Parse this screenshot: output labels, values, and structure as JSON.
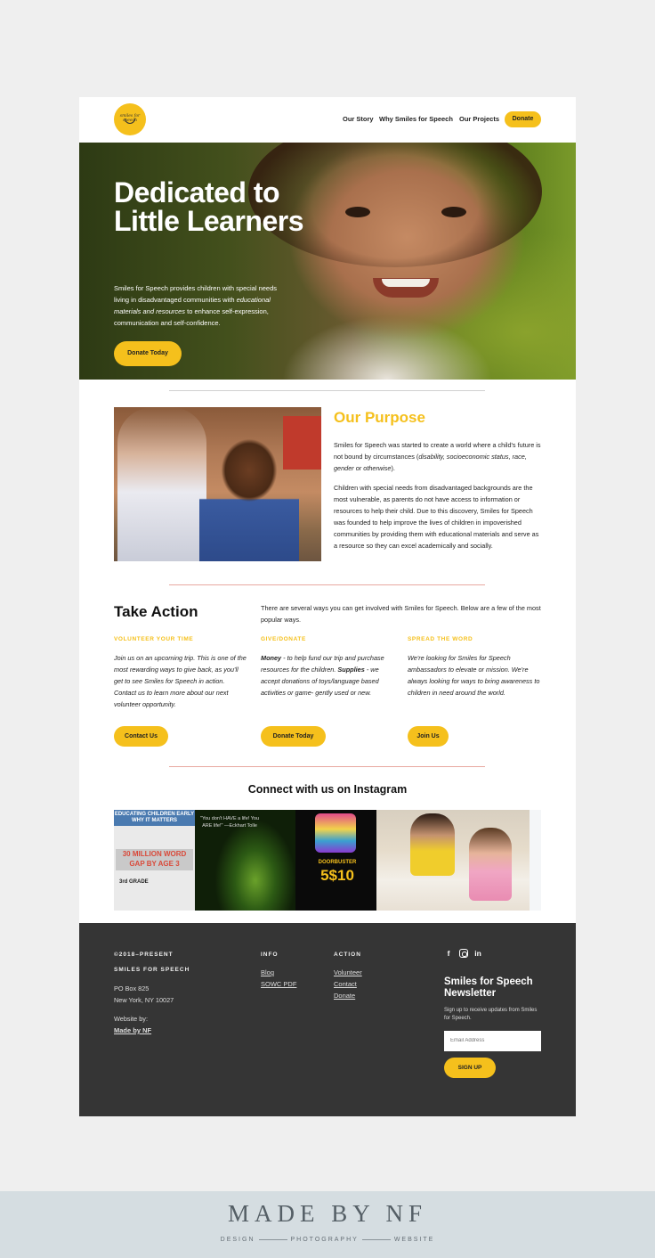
{
  "header": {
    "logo_text": "smiles for speech",
    "nav": [
      "Our Story",
      "Why Smiles for Speech",
      "Our Projects"
    ],
    "donate": "Donate"
  },
  "hero": {
    "title": "Dedicated to Little Learners",
    "text_1": "Smiles for Speech provides children with special needs living in disadvantaged communities with",
    "text_italic": "educational materials and resources",
    "text_2": "to enhance self-expression, communication and self-confidence.",
    "button": "Donate Today"
  },
  "purpose": {
    "title": "Our Purpose",
    "p1_a": "Smiles for Speech was started to create a world where a child's future is not bound by circumstances (",
    "p1_italic": "disability, socioeconomic status, race, gender or otherwise",
    "p1_b": ").",
    "p2": "Children with special needs from disadvantaged backgrounds are the most vulnerable, as parents do not have access to information or resources to help their child.  Due to this discovery, Smiles for Speech was founded to help improve the lives of children in impoverished communities by providing them with educational materials and serve as a resource so they can excel academically and socially."
  },
  "take_action": {
    "title": "Take Action",
    "intro": "There are several ways you can get involved with Smiles for Speech. Below are a few of the most popular ways.",
    "columns": [
      {
        "heading": "VOLUNTEER YOUR TIME",
        "text": "Join us on an upcoming trip. This is one of the most rewarding ways to give back, as you'll get to see Smiles for Speech in action. Contact us to learn more about our next volunteer opportunity.",
        "button": "Contact Us"
      },
      {
        "heading": "GIVE/DONATE",
        "money_label": "Money",
        "money_text": " - to help fund our trip and purchase resources for the children. ",
        "supplies_label": "Supplies",
        "supplies_text": " - we accept donations of toys/language based activities or game- gently used or new.",
        "button": "Donate Today"
      },
      {
        "heading": "SPREAD THE WORD",
        "text": "We're looking for Smiles for Speech ambassadors to elevate or mission.  We're always looking for ways to bring awareness to children in need around the world.",
        "button": "Join Us"
      }
    ]
  },
  "instagram": {
    "title": "Connect with us on Instagram",
    "post1_heading": "EDUCATING CHILDREN EARLY WHY IT MATTERS",
    "post1_stat": "30 MILLION WORD GAP BY AGE 3",
    "post1_grade": "3rd GRADE",
    "post2_quote": "\"You don't HAVE a life! You ARE life!\" —Eckhart Tolle",
    "post3_price": "5$10",
    "post3_label": "DOORBUSTER"
  },
  "footer": {
    "copyright": "©2018–PRESENT",
    "org": "SMILES FOR SPEECH",
    "address_1": "PO Box 825",
    "address_2": "New York, NY 10027",
    "website_by": "Website by:",
    "made_by": "Made by NF",
    "info_heading": "INFO",
    "info_links": [
      "Blog",
      "SOWC PDF"
    ],
    "action_heading": "ACTION",
    "action_links": [
      "Volunteer",
      "Contact",
      "Donate"
    ],
    "social": [
      "facebook",
      "instagram",
      "linkedin"
    ],
    "newsletter_title": "Smiles for Speech Newsletter",
    "newsletter_text": "Sign up to receive updates from Smiles for Speech.",
    "email_placeholder": "Email Address",
    "signup": "SIGN UP"
  },
  "brand_band": {
    "title": "MADE BY NF",
    "items": [
      "DESIGN",
      "PHOTOGRAPHY",
      "WEBSITE"
    ]
  },
  "colors": {
    "accent": "#f5c01c",
    "footer_bg": "#353535",
    "page_bg": "#efefef",
    "band_bg": "#d5dde1"
  }
}
